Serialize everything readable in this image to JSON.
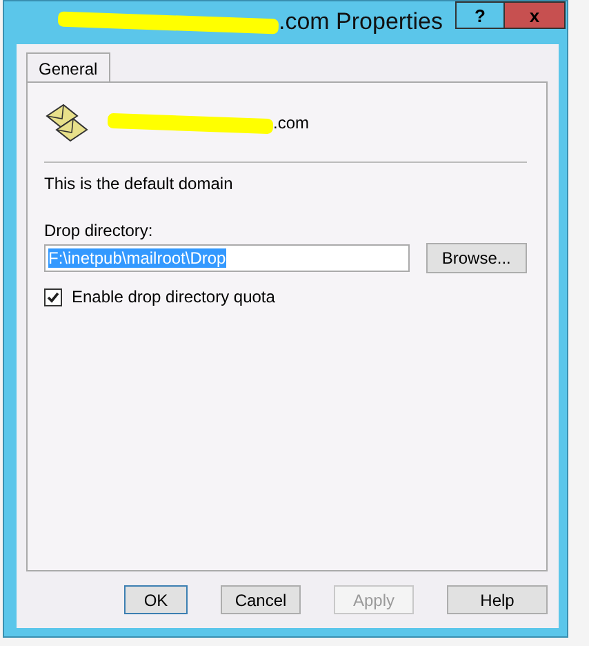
{
  "window": {
    "title": ".com Properties",
    "help_button": "?",
    "close_button": "x"
  },
  "tabs": [
    {
      "label": "General",
      "selected": true
    }
  ],
  "header": {
    "domain": ".com"
  },
  "default_note": "This is the default domain",
  "drop_directory": {
    "label": "Drop directory:",
    "value": "F:\\inetpub\\mailroot\\Drop",
    "browse": "Browse..."
  },
  "quota": {
    "label": "Enable drop directory quota",
    "checked": true
  },
  "buttons": [
    {
      "label": "OK",
      "disabled": false
    },
    {
      "label": "Cancel",
      "disabled": false
    },
    {
      "label": "Apply",
      "disabled": true
    },
    {
      "label": "Help",
      "disabled": false
    }
  ]
}
